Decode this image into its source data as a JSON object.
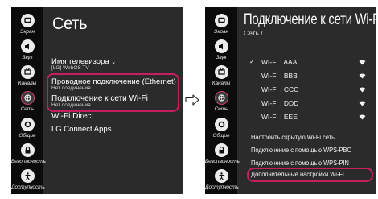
{
  "left_screen": {
    "title": "Сеть",
    "sidebar": [
      {
        "label": "Экран",
        "icon": "screen-icon"
      },
      {
        "label": "Звук",
        "icon": "sound-icon"
      },
      {
        "label": "Каналы",
        "icon": "channels-icon"
      },
      {
        "label": "Сеть",
        "icon": "network-icon"
      },
      {
        "label": "Общие",
        "icon": "general-icon"
      },
      {
        "label": "Безопасность",
        "icon": "security-icon"
      },
      {
        "label": "Доступность",
        "icon": "accessibility-icon"
      }
    ],
    "items": [
      {
        "label": "Имя телевизора",
        "sub": "[LG] WebOS TV"
      },
      {
        "label": "Проводное подключение (Ethernet)",
        "sub": "Нет соединения"
      },
      {
        "label": "Подключение к сети Wi-Fi",
        "sub": "Нет соединения"
      },
      {
        "label": "Wi-Fi Direct",
        "sub": ""
      },
      {
        "label": "LG Connect Apps",
        "sub": ""
      }
    ]
  },
  "right_screen": {
    "title": "Подключение к сети Wi-Fi",
    "breadcrumb": "Сеть /",
    "sidebar": [
      {
        "label": "Экран",
        "icon": "screen-icon"
      },
      {
        "label": "Звук",
        "icon": "sound-icon"
      },
      {
        "label": "Каналы",
        "icon": "channels-icon"
      },
      {
        "label": "Сеть",
        "icon": "network-icon"
      },
      {
        "label": "Общие",
        "icon": "general-icon"
      },
      {
        "label": "Безопасность",
        "icon": "security-icon"
      },
      {
        "label": "Доступность",
        "icon": "accessibility-icon"
      }
    ],
    "networks": [
      {
        "name": "WI-FI : AAA",
        "connected": true
      },
      {
        "name": "WI-FI : BBB",
        "connected": false
      },
      {
        "name": "WI-FI : CCC",
        "connected": false
      },
      {
        "name": "WI-FI : DDD",
        "connected": false
      },
      {
        "name": "WI-FI : EEE",
        "connected": false
      }
    ],
    "options": [
      "Настроить скрытую Wi-Fi сеть",
      "Подключение с помощью WPS-PBC",
      "Подключение с помощью WPS-PIN",
      "Дополнительные настройки Wi-Fi"
    ]
  },
  "check_mark": "✓",
  "colors": {
    "highlight": "#c51f60",
    "screen_bg": "#2b2b2b",
    "sidebar_bg": "#0b0b0b"
  }
}
